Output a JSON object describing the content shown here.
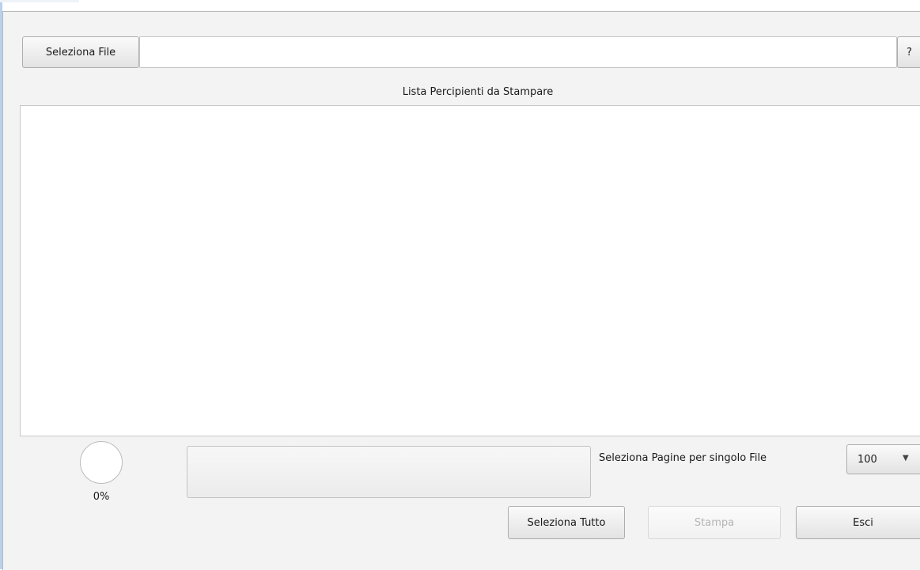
{
  "toolbar": {
    "select_file_label": "Seleziona File",
    "file_path_value": "",
    "file_path_placeholder": "",
    "help_label": "?"
  },
  "list": {
    "title": "Lista Percipienti da Stampare",
    "items": []
  },
  "progress": {
    "percent_text": "0%",
    "fraction": 0
  },
  "pages": {
    "label": "Seleziona Pagine per singolo File",
    "selected_value": "100",
    "caret_icon": "chevron-down-icon"
  },
  "actions": {
    "select_all_label": "Seleziona Tutto",
    "print_label": "Stampa",
    "exit_label": "Esci"
  }
}
